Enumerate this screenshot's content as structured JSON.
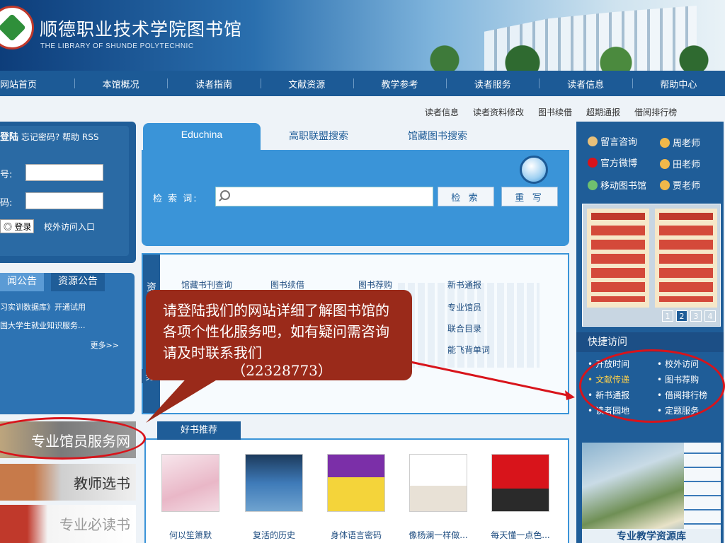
{
  "header": {
    "title": "顺德职业技术学院图书馆",
    "subtitle": "THE LIBRARY OF SHUNDE POLYTECHNIC"
  },
  "nav": [
    "网站首页",
    "本馆概况",
    "读者指南",
    "文献资源",
    "教学参考",
    "读者服务",
    "读者信息",
    "帮助中心"
  ],
  "sublinks": [
    "读者信息",
    "读者资料修改",
    "图书续借",
    "超期通报",
    "借阅排行榜"
  ],
  "login": {
    "title": "登陆",
    "forgot": "忘记密码?",
    "help": "帮助",
    "rss": "RSS",
    "account_label": "号:",
    "password_label": "码:",
    "login_button": "登录",
    "offcampus": "校外访问入口"
  },
  "notices": {
    "tab1": "闻公告",
    "tab2": "资源公告",
    "items": [
      "习实训数据库》开通试用",
      "国大学生就业知识服务..."
    ],
    "more": "更多>>"
  },
  "promos": [
    "专业馆员服务网",
    "教师选书",
    "专业必读书"
  ],
  "search": {
    "tabs": [
      "Educhina",
      "高职联盟搜索",
      "馆藏图书搜索"
    ],
    "label": "检 索 词:",
    "search_button": "检 索",
    "reset_button": "重 写"
  },
  "resources": {
    "side_top": "资",
    "side_bottom": "务",
    "links": [
      "馆藏书刊查询",
      "图书续借",
      "图书荐购",
      "新书通报",
      "专业馆员",
      "联合目录",
      "能飞背单词"
    ]
  },
  "bubble": {
    "text": "请登陆我们的网站详细了解图书馆的各项个性化服务吧，如有疑问需咨询请及时联系我们",
    "phone": "（22328773）"
  },
  "books": {
    "title": "好书推荐",
    "items": [
      "何以笙箫默",
      "复活的历史",
      "身体语言密码",
      "像杨澜一样做...",
      "每天懂一点色..."
    ]
  },
  "right": {
    "contacts": [
      "留言咨询",
      "周老师",
      "官方微博",
      "田老师",
      "移动图书馆",
      "贾老师"
    ],
    "pager": [
      "1",
      "2",
      "3",
      "4"
    ],
    "quick_title": "快捷访问",
    "quick": [
      "开放时间",
      "校外访问",
      "文献传递",
      "图书荐购",
      "新书通报",
      "借阅排行榜",
      "读者园地",
      "定题服务"
    ],
    "campus_label": "专业教学资源库"
  }
}
